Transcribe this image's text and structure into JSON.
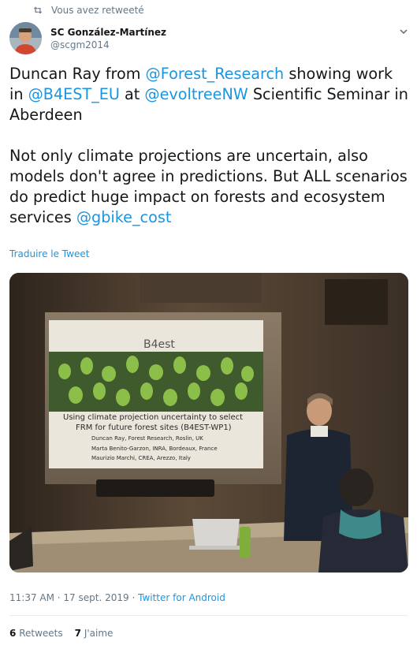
{
  "retweet": {
    "label": "Vous avez retweeté"
  },
  "author": {
    "name": "SC González-Martínez",
    "handle": "@scgm2014"
  },
  "tweet": {
    "line1_a": "Duncan Ray from ",
    "mention_forest": "@Forest_Research",
    "line1_b": " showing work in ",
    "mention_b4est": "@B4EST_EU",
    "line2_a": " at ",
    "mention_evoltree": "@evoltreeNW",
    "line2_b": " Scientific Seminar in Aberdeen",
    "para2": "Not only climate projections are uncertain, also models don't agree in predictions. But ALL scenarios do predict huge impact on forests and ecosystem services ",
    "mention_gbike": "@gbike_cost"
  },
  "translate_label": "Traduire le Tweet",
  "slide": {
    "logo": "B4est",
    "title_line1": "Using climate projection uncertainty to select",
    "title_line2": "FRM for future forest sites (B4EST-WP1)",
    "author1": "Duncan Ray, Forest Research, Roslin, UK",
    "author2": "Marta Benito-Garzon, INRA, Bordeaux, France",
    "author3": "Maurizio Marchi, CREA, Arezzo, Italy"
  },
  "meta": {
    "time": "11:37 AM",
    "date": "17 sept. 2019",
    "separator": " · ",
    "source": "Twitter for Android"
  },
  "stats": {
    "retweets_count": "6",
    "retweets_label": "Retweets",
    "likes_count": "7",
    "likes_label": "J'aime"
  },
  "colors": {
    "link": "#1b95e0",
    "secondary": "#657786",
    "text": "#14171a"
  },
  "icons": {
    "retweet": "retweet-icon",
    "chevron": "chevron-down-icon"
  }
}
